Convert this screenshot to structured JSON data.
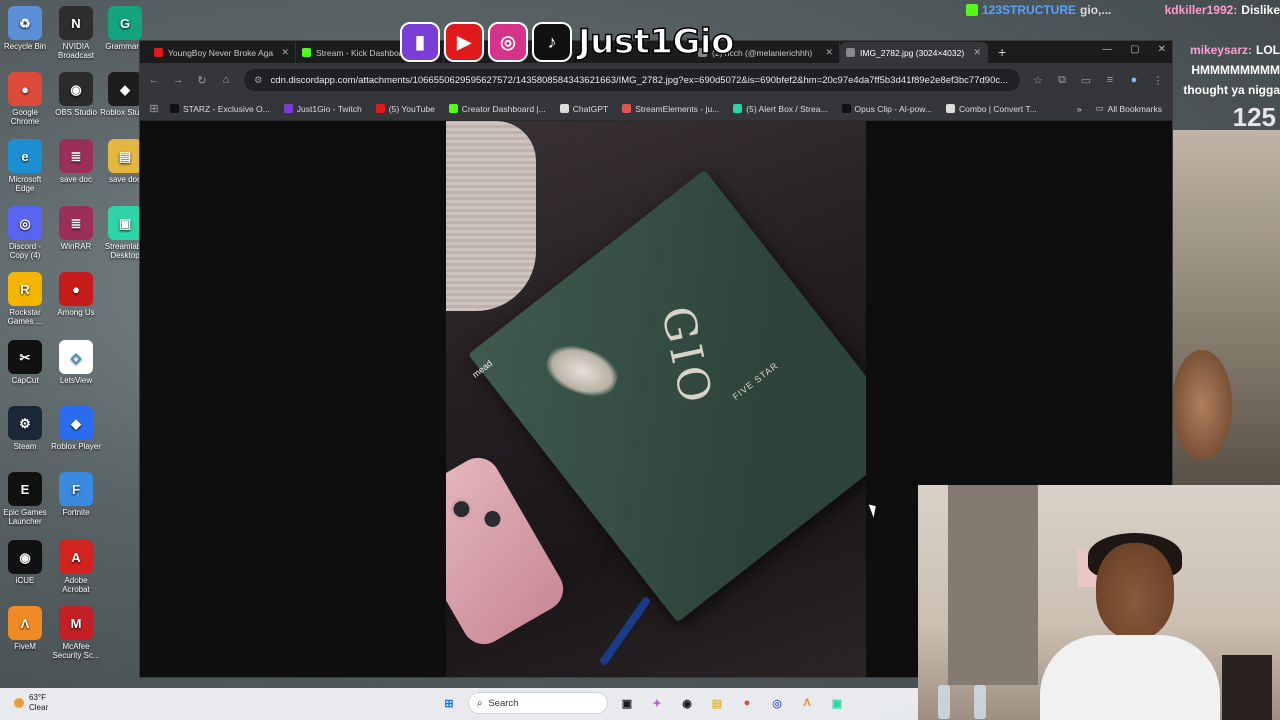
{
  "desktop_icons": [
    {
      "label": "Recycle Bin",
      "color": "#5b8fd6",
      "glyph": "♻"
    },
    {
      "label": "NVIDIA Broadcast",
      "color": "#2d2d2d",
      "glyph": "N"
    },
    {
      "label": "Grammarly",
      "color": "#14a37f",
      "glyph": "G"
    },
    {
      "label": "Google Chrome",
      "color": "#dd4a3c",
      "glyph": "●"
    },
    {
      "label": "OBS Studio",
      "color": "#2b2b2b",
      "glyph": "◉"
    },
    {
      "label": "Roblox Studio",
      "color": "#1d1d1d",
      "glyph": "◆"
    },
    {
      "label": "Microsoft Edge",
      "color": "#1b8fd2",
      "glyph": "e"
    },
    {
      "label": "save doc",
      "color": "#9c2f5a",
      "glyph": "≣"
    },
    {
      "label": "save doc",
      "color": "#e3b73d",
      "glyph": "▤"
    },
    {
      "label": "Discord - Copy (4)",
      "color": "#5865f2",
      "glyph": "◎"
    },
    {
      "label": "WinRAR",
      "color": "#9c2f5a",
      "glyph": "≣"
    },
    {
      "label": "Streamlabs Desktop",
      "color": "#2dd4a8",
      "glyph": "▣"
    },
    {
      "label": "Rockstar Games ...",
      "color": "#f5b400",
      "glyph": "R"
    },
    {
      "label": "Among Us",
      "color": "#c71a1a",
      "glyph": "●"
    },
    {
      "label": "CapCut",
      "color": "#111111",
      "glyph": "✂"
    },
    {
      "label": "LetsView",
      "color": "#ffffff",
      "glyph": "◇"
    },
    {
      "label": "Steam",
      "color": "#1b2838",
      "glyph": "⚙"
    },
    {
      "label": "Roblox Player",
      "color": "#2a6cf0",
      "glyph": "◆"
    },
    {
      "label": "Epic Games Launcher",
      "color": "#111111",
      "glyph": "E"
    },
    {
      "label": "Fortnite",
      "color": "#3a8be0",
      "glyph": "F"
    },
    {
      "label": "iCUE",
      "color": "#111111",
      "glyph": "◉"
    },
    {
      "label": "Adobe Acrobat",
      "color": "#d2231f",
      "glyph": "A"
    },
    {
      "label": "FiveM",
      "color": "#f08a24",
      "glyph": "Λ"
    },
    {
      "label": "McAfee Security Sc...",
      "color": "#c41f24",
      "glyph": "M"
    }
  ],
  "overlay": {
    "handle": "Just1Gio",
    "socials": [
      {
        "name": "twitch",
        "color": "#7a3ed6",
        "glyph": "▮"
      },
      {
        "name": "youtube",
        "color": "#e01a1a",
        "glyph": "▶"
      },
      {
        "name": "instagram",
        "color": "#d6338a",
        "glyph": "◎"
      },
      {
        "name": "tiktok",
        "color": "#111111",
        "glyph": "♪"
      }
    ]
  },
  "chat": {
    "lines": [
      {
        "user": "123STRUCTURE",
        "user_color": "#5aa0ff",
        "msg": "gio,...",
        "user2": "kdkiller1992:",
        "msg2": "Dislike"
      },
      {
        "user": "",
        "user_color": "#ff6b6b",
        "msg": "",
        "user2": "",
        "msg2": ""
      },
      {
        "user": "",
        "user_color": "#ffffff",
        "msg": "",
        "user2": "mikeysarz:",
        "msg2": "LOL"
      },
      {
        "user": "",
        "user_color": "#ffffff",
        "msg": "",
        "user2": "",
        "msg2": "HMMMMMMMM"
      },
      {
        "user": "",
        "user_color": "#ffffff",
        "msg": "",
        "user2": "",
        "msg2": "thought ya nigga"
      }
    ],
    "count": "125"
  },
  "browser": {
    "tabs": [
      {
        "label": "YoungBoy Never Broke Aga",
        "fav_color": "#e01a1a",
        "active": false
      },
      {
        "label": "Stream - Kick Dashboard",
        "fav_color": "#53fc18",
        "active": false
      },
      {
        "label": "(2) ricch (@melanierichhh)",
        "fav_color": "#888888",
        "active": false
      },
      {
        "label": "IMG_2782.jpg (3024×4032)",
        "fav_color": "#888888",
        "active": true
      }
    ],
    "url": "cdn.discordapp.com/attachments/1066550629595627572/1435808584343621663/IMG_2782.jpg?ex=690d5072&is=690bfef2&hm=20c97e4da7ff5b3d41f89e2e8ef3bc77d90c...",
    "bookmarks": [
      {
        "label": "STARZ - Exclusive O...",
        "fav_color": "#111111"
      },
      {
        "label": "Just1Gio - Twitch",
        "fav_color": "#7a3ed6"
      },
      {
        "label": "(5) YouTube",
        "fav_color": "#e01a1a"
      },
      {
        "label": "Creator Dashboard |...",
        "fav_color": "#53fc18"
      },
      {
        "label": "ChatGPT",
        "fav_color": "#dddddd"
      },
      {
        "label": "StreamElements - ju...",
        "fav_color": "#e05555"
      },
      {
        "label": "(5) Alert Box / Strea...",
        "fav_color": "#2dd4a8"
      },
      {
        "label": "Opus Clip - AI-pow...",
        "fav_color": "#111111"
      },
      {
        "label": "Combo | Convert T...",
        "fav_color": "#dddddd"
      }
    ],
    "all_bookmarks": "All Bookmarks"
  },
  "photo": {
    "notebook_text": "GIO",
    "brand": "FIVE STAR",
    "maker": "mead"
  },
  "taskbar": {
    "temp": "63°F",
    "condition": "Clear",
    "search_placeholder": "Search"
  }
}
